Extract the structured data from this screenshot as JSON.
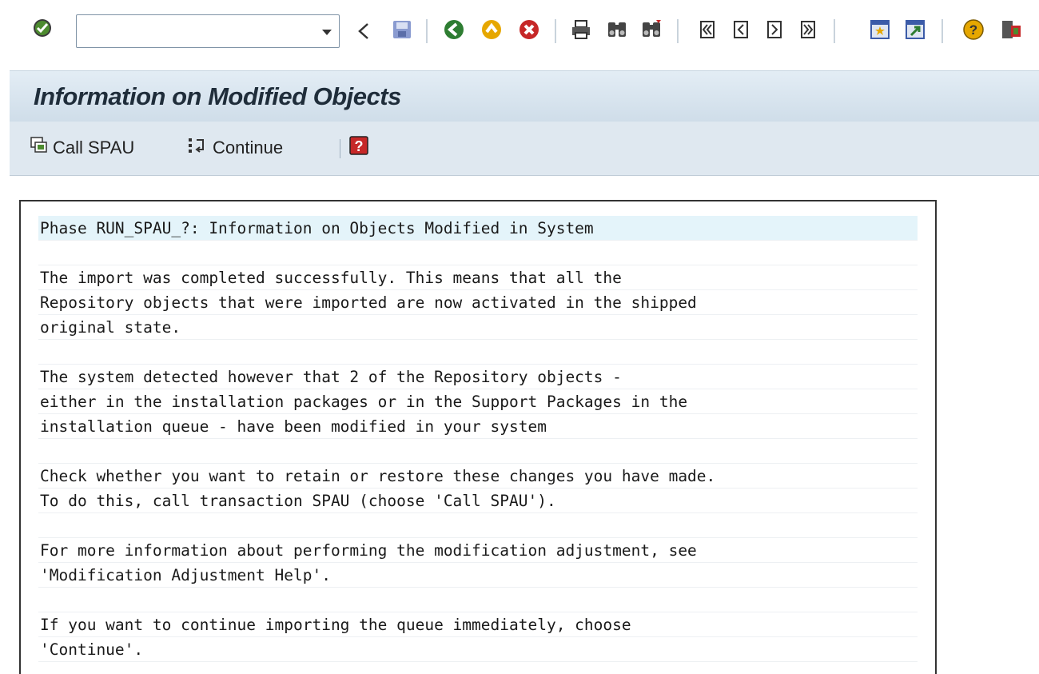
{
  "system_toolbar": {
    "command_field": {
      "value": "",
      "placeholder": ""
    },
    "icons": [
      "enter-check-icon",
      "command-dropdown-icon",
      "collapse-arrow-icon",
      "save-icon",
      "back-icon",
      "exit-icon",
      "cancel-icon",
      "print-icon",
      "find-icon",
      "find-next-icon",
      "first-page-icon",
      "previous-page-icon",
      "next-page-icon",
      "last-page-icon",
      "create-session-icon",
      "shortcut-icon",
      "help-icon",
      "customize-layout-icon"
    ]
  },
  "title": "Information on Modified Objects",
  "app_toolbar": {
    "call_spau_label": "Call SPAU",
    "continue_label": "Continue"
  },
  "text_lines": [
    "Phase RUN_SPAU_?: Information on Objects Modified in System",
    "",
    "The import was completed successfully. This means that all the",
    "Repository objects that were imported are now activated in the shipped",
    "original state.",
    "",
    "The system detected however that 2 of the Repository objects -",
    "either in the installation packages or in the Support Packages in the",
    "installation queue - have been modified in your system",
    "",
    "Check whether you want to retain or restore these changes you have made.",
    "To do this, call transaction SPAU (choose 'Call SPAU').",
    "",
    "For more information about performing the modification adjustment, see",
    "'Modification Adjustment Help'.",
    "",
    "If you want to continue importing the queue immediately, choose",
    "'Continue'."
  ],
  "colors": {
    "accent_green": "#2f8f2f",
    "accent_red": "#c62828",
    "accent_yellow": "#e6a700",
    "title_bg": "#d6e3ee"
  }
}
